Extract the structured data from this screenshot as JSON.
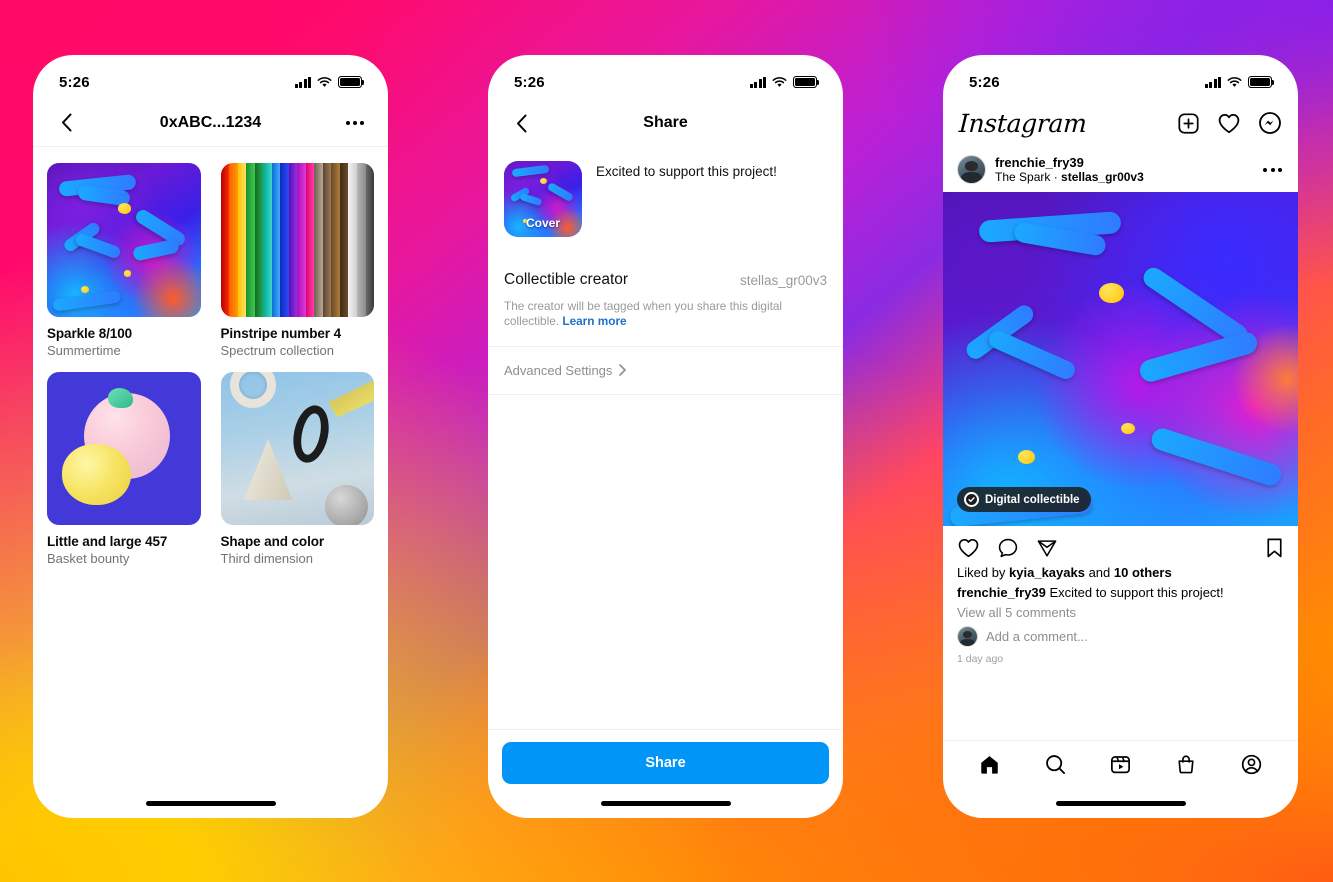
{
  "background": {
    "colors": [
      "#ff0a6c",
      "#b721d8",
      "#8a2be2",
      "#ff6a28",
      "#ffb400",
      "#ffd600"
    ]
  },
  "phones": {
    "collection": {
      "status": {
        "time": "5:26",
        "signal_icon": "cellular-signal-icon",
        "wifi_icon": "wifi-icon",
        "battery_icon": "battery-full-icon"
      },
      "nav": {
        "back_icon": "chevron-left-icon",
        "title": "0xABC...1234",
        "more_icon": "more-horizontal-icon"
      },
      "items": [
        {
          "title": "Sparkle 8/100",
          "subtitle": "Summertime",
          "art": "sparkle"
        },
        {
          "title": "Pinstripe number 4",
          "subtitle": "Spectrum collection",
          "art": "pinstripe"
        },
        {
          "title": "Little and large 457",
          "subtitle": "Basket bounty",
          "art": "little-and-large"
        },
        {
          "title": "Shape and color",
          "subtitle": "Third dimension",
          "art": "shapes"
        }
      ]
    },
    "share": {
      "status": {
        "time": "5:26",
        "signal_icon": "cellular-signal-icon",
        "wifi_icon": "wifi-icon",
        "battery_icon": "battery-full-icon"
      },
      "nav": {
        "back_icon": "chevron-left-icon",
        "title": "Share"
      },
      "cover_label": "Cover",
      "caption_value": "Excited to support this project!",
      "creator_label": "Collectible creator",
      "creator_value": "stellas_gr00v3",
      "creator_note": "The creator will be tagged when you share this digital collectible. ",
      "learn_more": "Learn more",
      "advanced_settings": "Advanced Settings",
      "chevron_icon": "chevron-right-icon",
      "share_button": "Share",
      "accent_color": "#0095f6"
    },
    "feed": {
      "status": {
        "time": "5:26",
        "signal_icon": "cellular-signal-icon",
        "wifi_icon": "wifi-icon",
        "battery_icon": "battery-full-icon"
      },
      "logo": "Instagram",
      "header_icons": [
        "new-post-icon",
        "heart-icon",
        "messenger-icon"
      ],
      "post": {
        "username": "frenchie_fry39",
        "subtitle_prefix": "The Spark · ",
        "subtitle_creator": "stellas_gr00v3",
        "more_icon": "more-horizontal-icon",
        "badge": "Digital collectible",
        "badge_icon": "verified-check-icon",
        "actions": [
          "heart-icon",
          "comment-icon",
          "share-paperplane-icon",
          "bookmark-icon"
        ],
        "likes_prefix": "Liked by ",
        "likes_user": "kyia_kayaks",
        "likes_mid": " and ",
        "likes_others": "10 others",
        "caption_user": "frenchie_fry39",
        "caption_text": " Excited to support this project!",
        "view_comments": "View all 5 comments",
        "add_comment": "Add a comment...",
        "timestamp": "1 day ago"
      },
      "tabs": [
        "home-icon",
        "search-icon",
        "reels-icon",
        "shop-icon",
        "profile-icon"
      ]
    }
  }
}
